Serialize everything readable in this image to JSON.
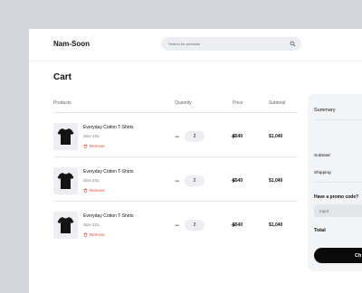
{
  "header": {
    "logo": "Nam-Soon",
    "search_placeholder": "Search for products"
  },
  "cart": {
    "title": "Cart",
    "columns": {
      "products": "Products",
      "quantity": "Quantity",
      "price": "Price",
      "subtotal": "Subtotal"
    },
    "items": [
      {
        "name": "Everyday Cotton T-Shirts",
        "size": "Size 2XL",
        "remove": "Remove",
        "minus": "−",
        "qty": "2",
        "plus": "+",
        "price": "$540",
        "subtotal": "$1,040",
        "image": "black-tshirt-image"
      },
      {
        "name": "Everyday Cotton T-Shirts",
        "size": "Size 2XL",
        "remove": "Remove",
        "minus": "−",
        "qty": "2",
        "plus": "+",
        "price": "$540",
        "subtotal": "$1,040",
        "image": "black-tshirt-image"
      },
      {
        "name": "Everyday Cotton T-Shirts",
        "size": "Size 2XL",
        "remove": "Remove",
        "minus": "−",
        "qty": "2",
        "plus": "+",
        "price": "$540",
        "subtotal": "$1,040",
        "image": "black-tshirt-image"
      }
    ]
  },
  "summary": {
    "title": "Summary",
    "subtotal_label": "Subtotal",
    "shipping_label": "Shipping",
    "promo_title": "Have a promo code?",
    "promo_placeholder": "Input",
    "total_label": "Total",
    "checkout_label": "Ch"
  },
  "colors": {
    "background": "#d3d6db",
    "accent": "#0b0b0b",
    "remove": "#e0443c",
    "chip": "#eceef1"
  },
  "icons": [
    "search-icon",
    "trash-icon",
    "tshirt-image"
  ]
}
